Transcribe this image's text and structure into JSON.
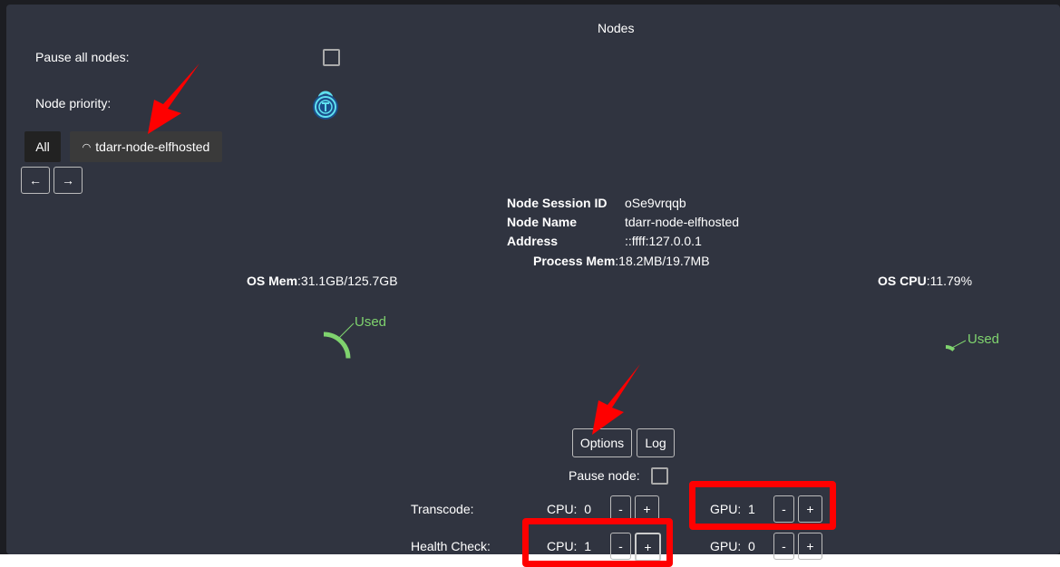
{
  "title": "Nodes",
  "pause_all_label": "Pause all nodes:",
  "node_priority_label": "Node priority:",
  "tabs": {
    "all": "All",
    "node": "tdarr-node-elfhosted"
  },
  "nav": {
    "prev": "←",
    "next": "→"
  },
  "info": {
    "session_label": "Node Session ID",
    "session": "oSe9vrqqb",
    "name_label": "Node Name",
    "name": "tdarr-node-elfhosted",
    "address_label": "Address",
    "address": "::ffff:127.0.0.1",
    "procmem_label": "Process Mem",
    "procmem": ":18.2MB/19.7MB"
  },
  "os_mem": {
    "label": "OS Mem",
    "value": ":31.1GB/125.7GB",
    "used_label": "Used",
    "used_fraction": 0.247
  },
  "os_cpu": {
    "label": "OS CPU",
    "value": ":11.79%",
    "used_label": "Used",
    "used_fraction": 0.1179
  },
  "options_label": "Options",
  "log_label": "Log",
  "pause_node_label": "Pause node:",
  "workers": [
    {
      "label": "Transcode:",
      "cpu": "CPU:  0",
      "gpu": "GPU:  1"
    },
    {
      "label": "Health Check:",
      "cpu": "CPU:  1",
      "gpu": "GPU:  0"
    }
  ],
  "minus": "-",
  "plus": "+",
  "colors": {
    "used": "#7fd36e",
    "annotation": "#ff0000"
  }
}
